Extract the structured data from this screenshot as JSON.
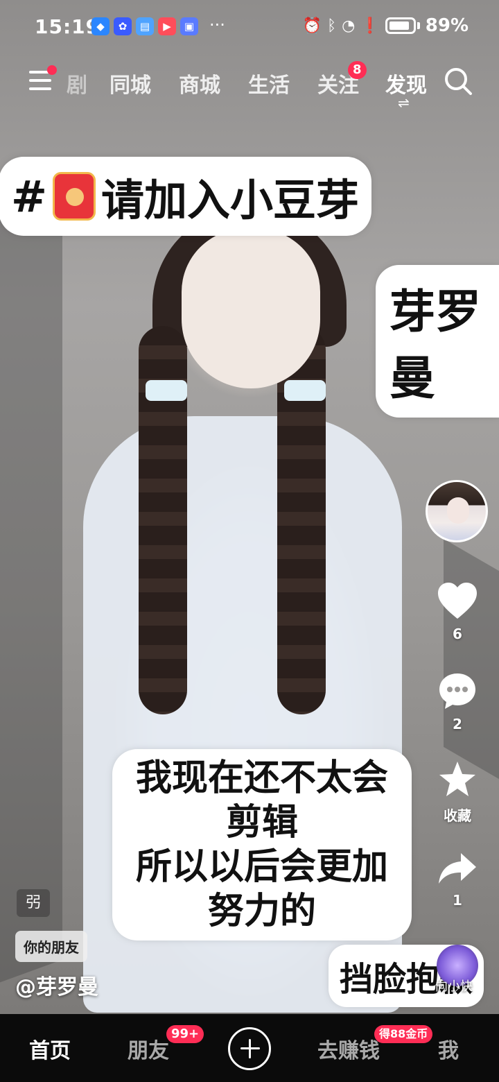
{
  "status_bar": {
    "time": "15:19",
    "more": "···",
    "battery_pct": "89%"
  },
  "top_nav": {
    "tabs": [
      {
        "label": "剧"
      },
      {
        "label": "同城"
      },
      {
        "label": "商城"
      },
      {
        "label": "生活"
      },
      {
        "label": "关注",
        "badge": "8"
      },
      {
        "label": "发现"
      }
    ]
  },
  "video": {
    "hashtag": "#",
    "hashtag_text": "请加入小豆芽",
    "name_sticker": "芽罗曼",
    "caption_line1": "我现在还不太会剪辑",
    "caption_line2": "所以以后会更加努力的",
    "shy_sticker": "挡脸抱歉"
  },
  "actions": {
    "like_count": "6",
    "comment_count": "2",
    "favorite_label": "收藏",
    "share_count": "1"
  },
  "info": {
    "music_tag": "弜",
    "friend_tag": "你的朋友",
    "author": "@芽罗曼",
    "music_text": "向小快"
  },
  "tab_bar": {
    "home": "首页",
    "friends": "朋友",
    "friends_badge": "99+",
    "earn": "去赚钱",
    "earn_badge": "得88金币",
    "me": "我"
  },
  "colors": {
    "accent": "#ff2d55",
    "tabbar_bg": "#0b0b0b"
  }
}
